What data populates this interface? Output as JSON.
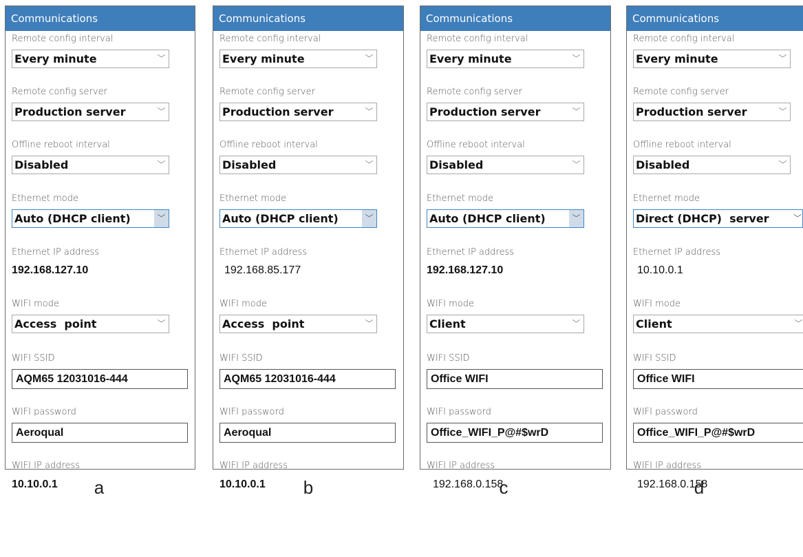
{
  "labels": {
    "header": "Communications",
    "remote_config_interval": "Remote config interval",
    "remote_config_server": "Remote config server",
    "offline_reboot_interval": "Offline reboot interval",
    "ethernet_mode": "Ethernet mode",
    "ethernet_ip": "Ethernet IP address",
    "wifi_mode": "WIFI mode",
    "wifi_ssid": "WIFI SSID",
    "wifi_password": "WIFI password",
    "wifi_ip": "WIFI IP address"
  },
  "icons": {
    "dropdown": "chevron-down-icon"
  },
  "colors": {
    "header_bg": "#3e7ebb",
    "focus_border": "#3f86c6"
  },
  "panels": [
    {
      "letter": "a",
      "remote_config_interval": "Every minute",
      "remote_config_server": "Production server",
      "offline_reboot_interval": "Disabled",
      "ethernet_mode": "Auto (DHCP client)",
      "ethernet_ip": "192.168.127.10",
      "wifi_mode": "Access  point",
      "wifi_ssid": "AQM65 12031016-444",
      "wifi_password": "Aeroqual",
      "wifi_ip": "10.10.0.1"
    },
    {
      "letter": "b",
      "remote_config_interval": "Every minute",
      "remote_config_server": "Production server",
      "offline_reboot_interval": "Disabled",
      "ethernet_mode": "Auto (DHCP client)",
      "ethernet_ip": "192.168.85.177",
      "wifi_mode": "Access  point",
      "wifi_ssid": "AQM65 12031016-444",
      "wifi_password": "Aeroqual",
      "wifi_ip": "10.10.0.1"
    },
    {
      "letter": "c",
      "remote_config_interval": "Every minute",
      "remote_config_server": "Production server",
      "offline_reboot_interval": "Disabled",
      "ethernet_mode": "Auto (DHCP client)",
      "ethernet_ip": "192.168.127.10",
      "wifi_mode": "Client",
      "wifi_ssid": "Office WIFI",
      "wifi_password": "Office_WIFI_P@#$wrD",
      "wifi_ip": "192.168.0.158"
    },
    {
      "letter": "d",
      "remote_config_interval": "Every minute",
      "remote_config_server": "Production server",
      "offline_reboot_interval": "Disabled",
      "ethernet_mode": "Direct (DHCP)  server",
      "ethernet_ip": "10.10.0.1",
      "wifi_mode": "Client",
      "wifi_ssid": "Office WIFI",
      "wifi_password": "Office_WIFI_P@#$wrD",
      "wifi_ip": "192.168.0.158"
    }
  ]
}
